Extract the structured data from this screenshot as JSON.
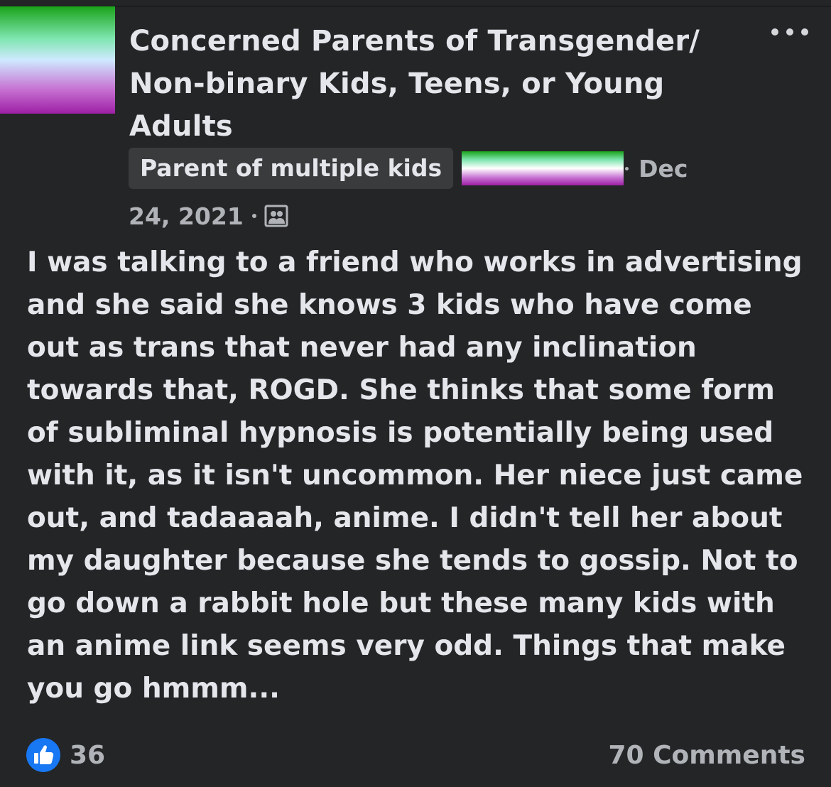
{
  "post": {
    "group_name": "Concerned Parents of Transgender/ Non-binary Kids, Teens, or Young Adults",
    "role_badge": "Parent of multiple kids",
    "date_part1": "Dec",
    "date_part2": "24, 2021",
    "privacy_icon": "members-only-group-icon",
    "body": "I was talking to a friend who works in advertising and she said she knows 3 kids who have come out as trans that never had any inclination towards that, ROGD. She thinks that some form of subliminal hypnosis is potentially being used with it, as it isn't uncommon. Her niece just came out, and tadaaaah, anime. I didn't tell her about my daughter because she tends to gossip. Not to go down a rabbit hole but these many kids with an anime link seems very odd. Things that make you go hmmm..."
  },
  "footer": {
    "like_count": "36",
    "comments_label": "70 Comments"
  },
  "colors": {
    "background": "#242526",
    "primary_text": "#e4e6eb",
    "secondary_text": "#b0b3b8",
    "badge_bg": "#3a3b3c",
    "like_blue": "#1877f2"
  },
  "icons": {
    "more": "more-options-icon",
    "like": "like-thumb-icon"
  }
}
